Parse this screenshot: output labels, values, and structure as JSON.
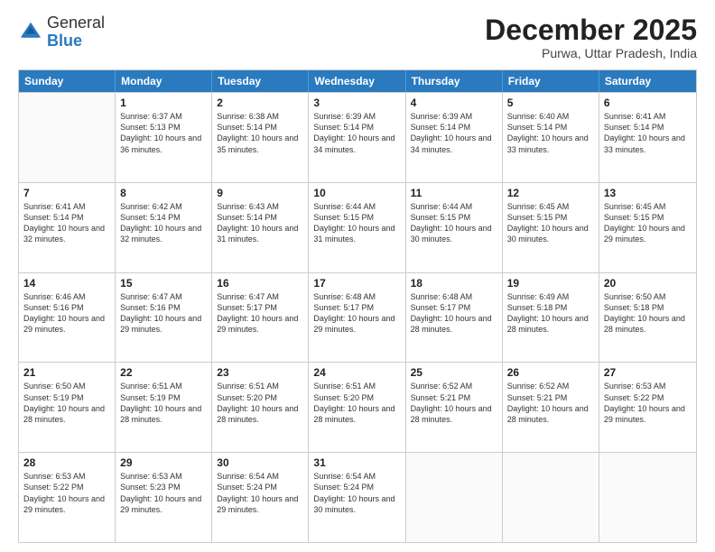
{
  "logo": {
    "general": "General",
    "blue": "Blue"
  },
  "header": {
    "month": "December 2025",
    "location": "Purwa, Uttar Pradesh, India"
  },
  "weekdays": [
    "Sunday",
    "Monday",
    "Tuesday",
    "Wednesday",
    "Thursday",
    "Friday",
    "Saturday"
  ],
  "weeks": [
    [
      {
        "day": "",
        "empty": true
      },
      {
        "day": "1",
        "sunrise": "Sunrise: 6:37 AM",
        "sunset": "Sunset: 5:13 PM",
        "daylight": "Daylight: 10 hours and 36 minutes."
      },
      {
        "day": "2",
        "sunrise": "Sunrise: 6:38 AM",
        "sunset": "Sunset: 5:14 PM",
        "daylight": "Daylight: 10 hours and 35 minutes."
      },
      {
        "day": "3",
        "sunrise": "Sunrise: 6:39 AM",
        "sunset": "Sunset: 5:14 PM",
        "daylight": "Daylight: 10 hours and 34 minutes."
      },
      {
        "day": "4",
        "sunrise": "Sunrise: 6:39 AM",
        "sunset": "Sunset: 5:14 PM",
        "daylight": "Daylight: 10 hours and 34 minutes."
      },
      {
        "day": "5",
        "sunrise": "Sunrise: 6:40 AM",
        "sunset": "Sunset: 5:14 PM",
        "daylight": "Daylight: 10 hours and 33 minutes."
      },
      {
        "day": "6",
        "sunrise": "Sunrise: 6:41 AM",
        "sunset": "Sunset: 5:14 PM",
        "daylight": "Daylight: 10 hours and 33 minutes."
      }
    ],
    [
      {
        "day": "7",
        "sunrise": "Sunrise: 6:41 AM",
        "sunset": "Sunset: 5:14 PM",
        "daylight": "Daylight: 10 hours and 32 minutes."
      },
      {
        "day": "8",
        "sunrise": "Sunrise: 6:42 AM",
        "sunset": "Sunset: 5:14 PM",
        "daylight": "Daylight: 10 hours and 32 minutes."
      },
      {
        "day": "9",
        "sunrise": "Sunrise: 6:43 AM",
        "sunset": "Sunset: 5:14 PM",
        "daylight": "Daylight: 10 hours and 31 minutes."
      },
      {
        "day": "10",
        "sunrise": "Sunrise: 6:44 AM",
        "sunset": "Sunset: 5:15 PM",
        "daylight": "Daylight: 10 hours and 31 minutes."
      },
      {
        "day": "11",
        "sunrise": "Sunrise: 6:44 AM",
        "sunset": "Sunset: 5:15 PM",
        "daylight": "Daylight: 10 hours and 30 minutes."
      },
      {
        "day": "12",
        "sunrise": "Sunrise: 6:45 AM",
        "sunset": "Sunset: 5:15 PM",
        "daylight": "Daylight: 10 hours and 30 minutes."
      },
      {
        "day": "13",
        "sunrise": "Sunrise: 6:45 AM",
        "sunset": "Sunset: 5:15 PM",
        "daylight": "Daylight: 10 hours and 29 minutes."
      }
    ],
    [
      {
        "day": "14",
        "sunrise": "Sunrise: 6:46 AM",
        "sunset": "Sunset: 5:16 PM",
        "daylight": "Daylight: 10 hours and 29 minutes."
      },
      {
        "day": "15",
        "sunrise": "Sunrise: 6:47 AM",
        "sunset": "Sunset: 5:16 PM",
        "daylight": "Daylight: 10 hours and 29 minutes."
      },
      {
        "day": "16",
        "sunrise": "Sunrise: 6:47 AM",
        "sunset": "Sunset: 5:17 PM",
        "daylight": "Daylight: 10 hours and 29 minutes."
      },
      {
        "day": "17",
        "sunrise": "Sunrise: 6:48 AM",
        "sunset": "Sunset: 5:17 PM",
        "daylight": "Daylight: 10 hours and 29 minutes."
      },
      {
        "day": "18",
        "sunrise": "Sunrise: 6:48 AM",
        "sunset": "Sunset: 5:17 PM",
        "daylight": "Daylight: 10 hours and 28 minutes."
      },
      {
        "day": "19",
        "sunrise": "Sunrise: 6:49 AM",
        "sunset": "Sunset: 5:18 PM",
        "daylight": "Daylight: 10 hours and 28 minutes."
      },
      {
        "day": "20",
        "sunrise": "Sunrise: 6:50 AM",
        "sunset": "Sunset: 5:18 PM",
        "daylight": "Daylight: 10 hours and 28 minutes."
      }
    ],
    [
      {
        "day": "21",
        "sunrise": "Sunrise: 6:50 AM",
        "sunset": "Sunset: 5:19 PM",
        "daylight": "Daylight: 10 hours and 28 minutes."
      },
      {
        "day": "22",
        "sunrise": "Sunrise: 6:51 AM",
        "sunset": "Sunset: 5:19 PM",
        "daylight": "Daylight: 10 hours and 28 minutes."
      },
      {
        "day": "23",
        "sunrise": "Sunrise: 6:51 AM",
        "sunset": "Sunset: 5:20 PM",
        "daylight": "Daylight: 10 hours and 28 minutes."
      },
      {
        "day": "24",
        "sunrise": "Sunrise: 6:51 AM",
        "sunset": "Sunset: 5:20 PM",
        "daylight": "Daylight: 10 hours and 28 minutes."
      },
      {
        "day": "25",
        "sunrise": "Sunrise: 6:52 AM",
        "sunset": "Sunset: 5:21 PM",
        "daylight": "Daylight: 10 hours and 28 minutes."
      },
      {
        "day": "26",
        "sunrise": "Sunrise: 6:52 AM",
        "sunset": "Sunset: 5:21 PM",
        "daylight": "Daylight: 10 hours and 28 minutes."
      },
      {
        "day": "27",
        "sunrise": "Sunrise: 6:53 AM",
        "sunset": "Sunset: 5:22 PM",
        "daylight": "Daylight: 10 hours and 29 minutes."
      }
    ],
    [
      {
        "day": "28",
        "sunrise": "Sunrise: 6:53 AM",
        "sunset": "Sunset: 5:22 PM",
        "daylight": "Daylight: 10 hours and 29 minutes."
      },
      {
        "day": "29",
        "sunrise": "Sunrise: 6:53 AM",
        "sunset": "Sunset: 5:23 PM",
        "daylight": "Daylight: 10 hours and 29 minutes."
      },
      {
        "day": "30",
        "sunrise": "Sunrise: 6:54 AM",
        "sunset": "Sunset: 5:24 PM",
        "daylight": "Daylight: 10 hours and 29 minutes."
      },
      {
        "day": "31",
        "sunrise": "Sunrise: 6:54 AM",
        "sunset": "Sunset: 5:24 PM",
        "daylight": "Daylight: 10 hours and 30 minutes."
      },
      {
        "day": "",
        "empty": true
      },
      {
        "day": "",
        "empty": true
      },
      {
        "day": "",
        "empty": true
      }
    ]
  ]
}
